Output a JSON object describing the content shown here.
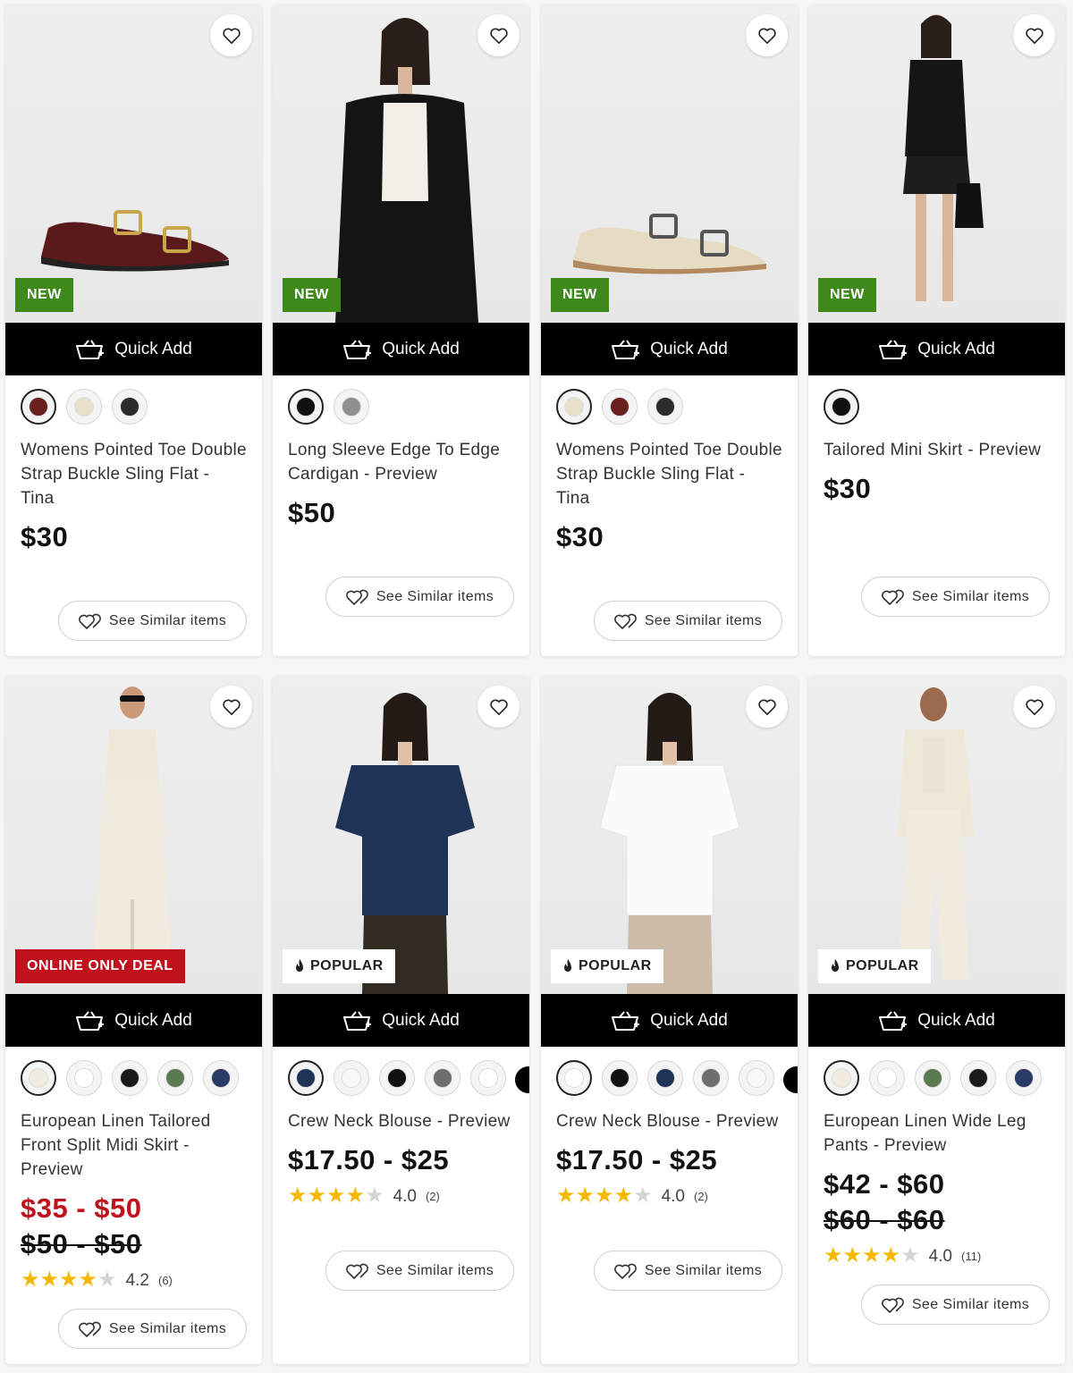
{
  "quick_add_label": "Quick Add",
  "similar_label": "See Similar items",
  "products": [
    {
      "badge": "NEW",
      "name": "Womens Pointed Toe Double Strap Buckle Sling Flat - Tina",
      "price": "$30",
      "swatch_colors": [
        "#6b1f1f",
        "#e9e0cc",
        "#2b2b2b"
      ]
    },
    {
      "badge": "NEW",
      "name": "Long Sleeve Edge To Edge Cardigan - Preview",
      "price": "$50",
      "swatch_colors": [
        "#111111",
        "#8f8f8f"
      ]
    },
    {
      "badge": "NEW",
      "name": "Womens Pointed Toe Double Strap Buckle Sling Flat - Tina",
      "price": "$30",
      "swatch_colors": [
        "#e9e0cc",
        "#6b1f1f",
        "#2b2b2b"
      ]
    },
    {
      "badge": "NEW",
      "name": "Tailored Mini Skirt - Preview",
      "price": "$30",
      "swatch_colors": [
        "#111111"
      ]
    },
    {
      "badge": "ONLINE ONLY DEAL",
      "name": "European Linen Tailored Front Split Midi Skirt - Preview",
      "price": "$35 - $50",
      "was_price": "$50 - $50",
      "rating": 4.2,
      "rating_text": "4.2",
      "review_count": "(6)",
      "swatch_colors": [
        "#f1ecdf",
        "#ffffff",
        "#1a1a1a",
        "#5b7a52",
        "#2a3b66"
      ]
    },
    {
      "badge": "POPULAR",
      "name": "Crew Neck Blouse - Preview",
      "price": "$17.50 - $25",
      "rating": 4.0,
      "rating_text": "4.0",
      "review_count": "(2)",
      "swatch_colors": [
        "#1f3357",
        "#f8f8f8",
        "#111111",
        "#6e6e6e",
        "#ffffff"
      ]
    },
    {
      "badge": "POPULAR",
      "name": "Crew Neck Blouse - Preview",
      "price": "$17.50 - $25",
      "rating": 4.0,
      "rating_text": "4.0",
      "review_count": "(2)",
      "swatch_colors": [
        "#ffffff",
        "#111111",
        "#1f3357",
        "#6e6e6e",
        "#f8f8f8"
      ]
    },
    {
      "badge": "POPULAR",
      "name": "European Linen Wide Leg Pants - Preview",
      "price": "$42 - $60",
      "was_price": "$60 - $60",
      "rating": 4.0,
      "rating_text": "4.0",
      "review_count": "(11)",
      "swatch_colors": [
        "#f1ecdf",
        "#ffffff",
        "#5b7a52",
        "#1a1a1a",
        "#2a3b66"
      ]
    }
  ]
}
